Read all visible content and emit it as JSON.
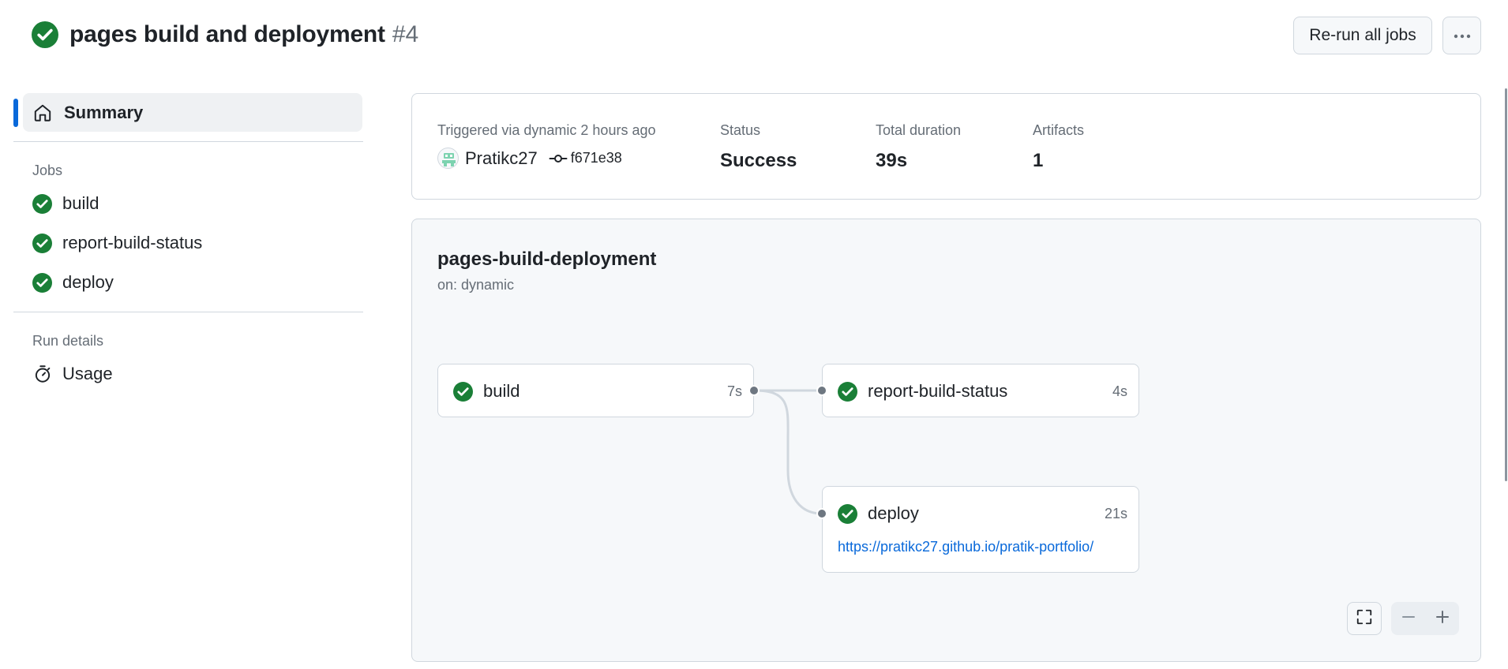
{
  "header": {
    "status_icon": "check-circle-icon",
    "title": "pages build and deployment",
    "run_number": "#4",
    "rerun_label": "Re-run all jobs",
    "more_icon": "kebab-horizontal-icon"
  },
  "sidebar": {
    "summary": {
      "label": "Summary",
      "icon": "home-icon"
    },
    "jobs_heading": "Jobs",
    "jobs": [
      {
        "label": "build",
        "icon": "check-circle-icon"
      },
      {
        "label": "report-build-status",
        "icon": "check-circle-icon"
      },
      {
        "label": "deploy",
        "icon": "check-circle-icon"
      }
    ],
    "run_details_heading": "Run details",
    "usage": {
      "label": "Usage",
      "icon": "stopwatch-icon"
    }
  },
  "summary": {
    "trigger_label": "Triggered via dynamic 2 hours ago",
    "actor": "Pratikc27",
    "commit_sha": "f671e38",
    "status_label": "Status",
    "status_value": "Success",
    "duration_label": "Total duration",
    "duration_value": "39s",
    "artifacts_label": "Artifacts",
    "artifacts_value": "1"
  },
  "graph": {
    "workflow_name": "pages-build-deployment",
    "trigger": "on: dynamic",
    "jobs": [
      {
        "name": "build",
        "duration": "7s"
      },
      {
        "name": "report-build-status",
        "duration": "4s"
      },
      {
        "name": "deploy",
        "duration": "21s",
        "url": "https://pratikc27.github.io/pratik-portfolio/"
      }
    ],
    "controls": {
      "fullscreen_icon": "screen-full-icon",
      "zoom_out_icon": "dash-icon",
      "zoom_in_icon": "plus-icon"
    }
  },
  "colors": {
    "success": "#1a7f37",
    "accent": "#0969da",
    "border": "#d0d7de",
    "muted": "#656d76"
  }
}
